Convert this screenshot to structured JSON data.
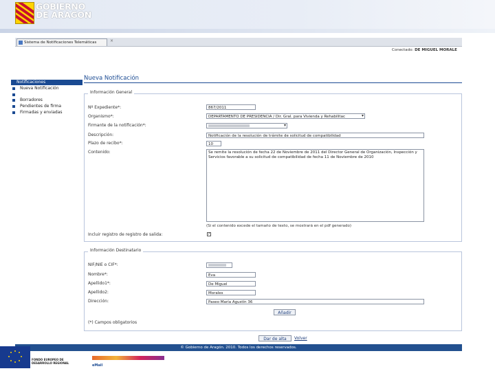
{
  "header": {
    "logo_line1": "GOBIERNO",
    "logo_line2": "DE ARAGON",
    "logo_icon": "aragon-shield-icon"
  },
  "browser": {
    "tab_label": "Sistema de Notificaciones Telemáticas",
    "tab_close": "×"
  },
  "user": {
    "prefix": "Conectado:",
    "name": "DE MIGUEL MORALE"
  },
  "sidebar": {
    "header": "Notificaciones",
    "items": [
      {
        "label": "Nueva Notificación"
      },
      {
        "label": "Borradores"
      },
      {
        "label": "Pendientes de firma"
      },
      {
        "label": "Firmadas y enviadas"
      }
    ]
  },
  "page": {
    "title": "Nueva Notificación",
    "sections": {
      "general": "Información General",
      "recipient": "Información Destinatario"
    }
  },
  "form": {
    "expediente": {
      "label": "Nº Expediente*:",
      "value": "867/2011"
    },
    "organismo": {
      "label": "Organismo*:",
      "value": "DEPARTAMENTO DE PRESIDENCIA / Dir. Gral. para Vivienda y Rehabilitac"
    },
    "firmante": {
      "label": "Firmante de la notificación*:",
      "value": ""
    },
    "descripcion": {
      "label": "Descripción:",
      "value": "Notificación de la resolución de trámite de solicitud de compatibilidad"
    },
    "plazo": {
      "label": "Plazo de recibo*:",
      "value": "10"
    },
    "contenido": {
      "label": "Contenido:",
      "value": "Se remite la resolución de fecha 22 de Noviembre de 2011 del Director General de Organización, Inspección y Servicios favorable a su solicitud de compatibilidad de fecha 11 de Noviembre de 2010"
    },
    "contenido_note": "(Si el contenido excede el tamaño de texto, se mostrará en el pdf generado)",
    "registro": {
      "label": "Incluir registro de registro de salida:",
      "checked": "✓"
    },
    "nif": {
      "label": "NIF/NIE o CIF*:",
      "value": ""
    },
    "nombre": {
      "label": "Nombre*:",
      "value": "Eva"
    },
    "apellido1": {
      "label": "Apellido1*:",
      "value": "De Miguel"
    },
    "apellido2": {
      "label": "Apellido2:",
      "value": "Morales"
    },
    "direccion": {
      "label": "Dirección:",
      "value": "Paseo María Agustín 36"
    },
    "add_button": "Añadir",
    "required_note": "(*) Campos obligatorios"
  },
  "actions": {
    "submit": "Dar de alta",
    "back": "Volver"
  },
  "footer": {
    "copyright": "© Gobierno de Aragón. 2010. Todos los derechos reservados.",
    "eu_icon": "eu-flag-icon",
    "fondo_line1": "FONDO EUROPEO DE",
    "fondo_line2": "DESARROLLO REGIONAL",
    "program_sub": "eMail"
  },
  "colors": {
    "brand_blue": "#1a4a92",
    "footer_blue": "#22508f",
    "aragon_yellow": "#ffd400",
    "aragon_red": "#c8102e"
  }
}
